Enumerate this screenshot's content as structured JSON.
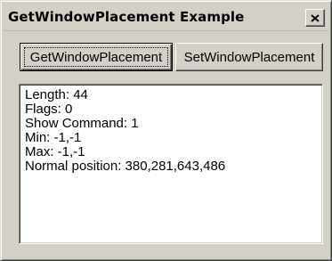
{
  "window": {
    "title": "GetWindowPlacement Example",
    "close_icon": "close-x-icon"
  },
  "buttons": {
    "get_label": "GetWindowPlacement",
    "set_label": "SetWindowPlacement"
  },
  "output": {
    "lines": [
      "Length: 44",
      "Flags: 0",
      "Show Command: 1",
      "Min: -1,-1",
      "Max: -1,-1",
      "Normal position: 380,281,643,486"
    ]
  },
  "colors": {
    "face": "#d4d0c8",
    "shadow": "#808080",
    "dark_shadow": "#404040",
    "highlight": "#ffffff",
    "text": "#000000"
  }
}
